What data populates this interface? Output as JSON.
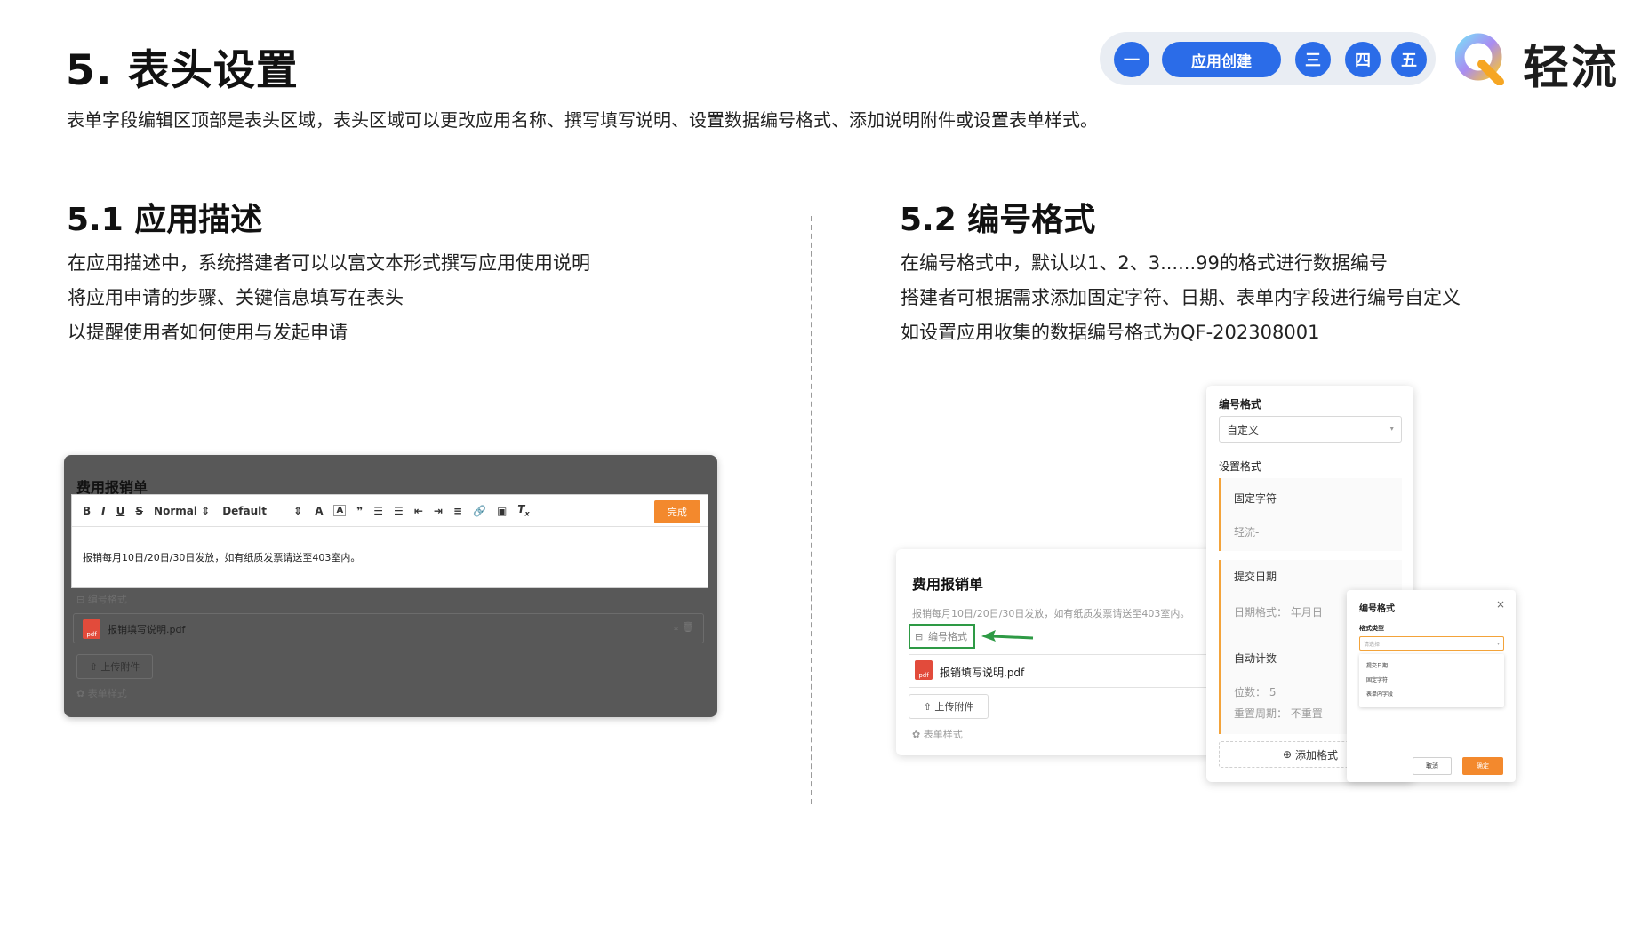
{
  "header": {
    "title": "5. 表头设置",
    "intro": "表单字段编辑区顶部是表头区域，表头区域可以更改应用名称、撰写填写说明、设置数据编号格式、添加说明附件或设置表单样式。"
  },
  "steps": {
    "items": [
      "一",
      "应用创建",
      "三",
      "四",
      "五"
    ],
    "active_color": "#2b6ce8"
  },
  "logo": {
    "text": "轻流"
  },
  "section1": {
    "title": "5.1 应用描述",
    "lines": [
      "在应用描述中，系统搭建者可以以富文本形式撰写应用使用说明",
      "将应用申请的步骤、关键信息填写在表头",
      "以提醒使用者如何使用与发起申请"
    ]
  },
  "section2": {
    "title": "5.2 编号格式",
    "lines": [
      "在编号格式中，默认以1、2、3......99的格式进行数据编号",
      "搭建者可根据需求添加固定字符、日期、表单内字段进行编号自定义",
      "如设置应用收集的数据编号格式为QF-202308001"
    ]
  },
  "mock1": {
    "form_title": "费用报销单",
    "toolbar": {
      "bold": "B",
      "italic": "I",
      "underline": "U",
      "strike": "S",
      "size": "Normal",
      "font": "Default",
      "done": "完成"
    },
    "content": "报销每月10日/20日/30日发放，如有纸质发票请送至403室内。",
    "number_format": "编号格式",
    "attachment": "报销填写说明.pdf",
    "upload": "上传附件",
    "form_style": "表单样式"
  },
  "mock2": {
    "form_title": "费用报销单",
    "desc": "报销每月10日/20日/30日发放，如有纸质发票请送至403室内。",
    "number_format": "编号格式",
    "attachment": "报销填写说明.pdf",
    "upload": "上传附件",
    "form_style": "表单样式",
    "pdf_label": "pdf"
  },
  "panel": {
    "title": "编号格式",
    "select_value": "自定义",
    "set_format": "设置格式",
    "fixed_label": "固定字符",
    "fixed_value": "轻流-",
    "date_label": "提交日期",
    "date_format": "日期格式：  年月日",
    "counter_label": "自动计数",
    "digits": "位数：  5",
    "reset": "重置周期：  不重置",
    "add": "添加格式"
  },
  "dialog": {
    "title": "编号格式",
    "close": "×",
    "type_label": "格式类型",
    "placeholder": "请选择",
    "options": [
      "提交日期",
      "固定字符",
      "表单内字段"
    ],
    "cancel": "取消",
    "ok": "确定"
  },
  "colors": {
    "accent_blue": "#2b6ce8",
    "orange": "#f3892d",
    "highlight_green": "#2e9a45"
  }
}
